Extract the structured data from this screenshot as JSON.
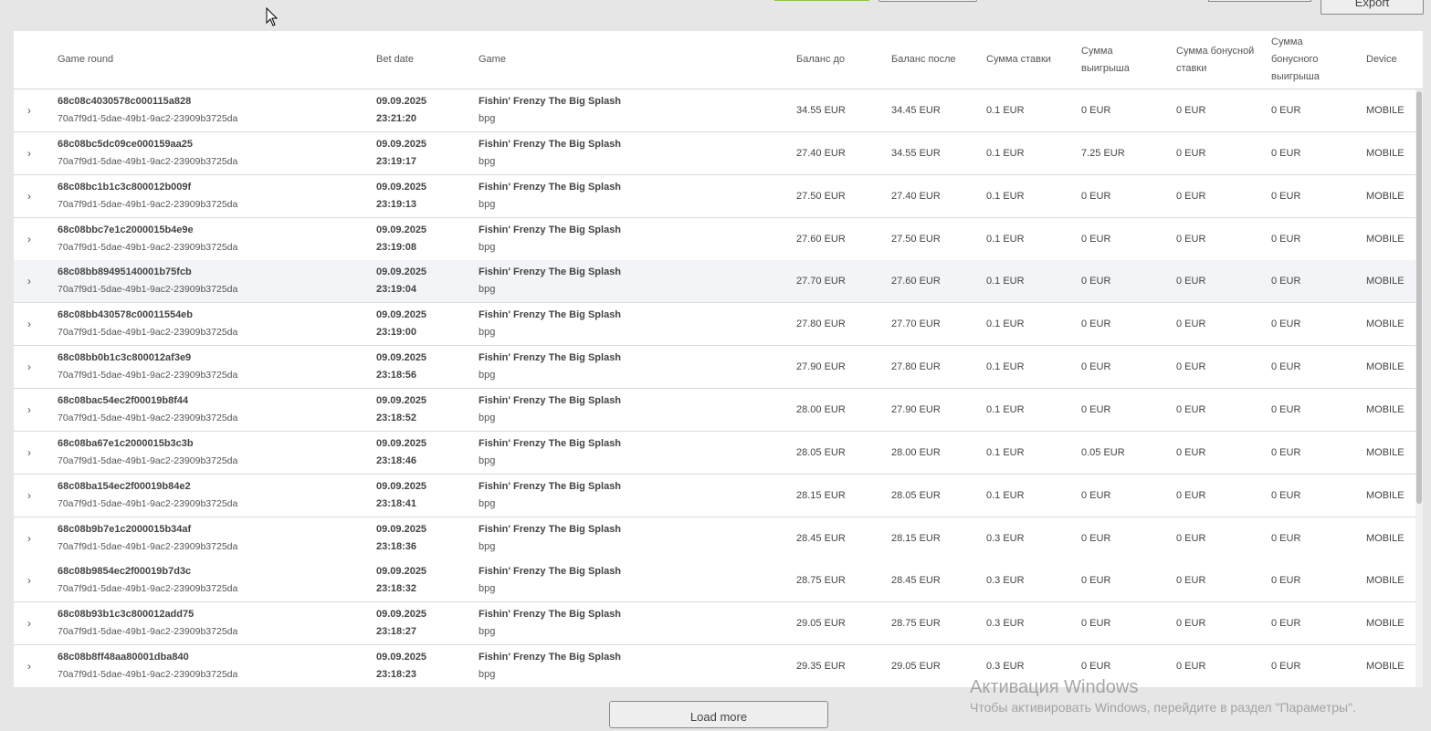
{
  "toolbar": {
    "export_label": "Export"
  },
  "table": {
    "headers": {
      "game_round": "Game round",
      "bet_date": "Bet date",
      "game": "Game",
      "balance_before": "Баланс до",
      "balance_after": "Баланс после",
      "bet_amount": "Сумма ставки",
      "win_amount": "Сумма выигрыша",
      "bonus_bet_amount": "Сумма бонусной ставки",
      "bonus_win_amount": "Сумма бонусного выигрыша",
      "device": "Device"
    },
    "rows": [
      {
        "round_id": "68c08c4030578c000115a828",
        "round_sub": "70a7f9d1-5dae-49b1-9ac2-23909b3725da",
        "date": "09.09.2025",
        "time": "23:21:20",
        "game": "Fishin' Frenzy The Big Splash",
        "provider": "bpg",
        "balance_before": "34.55 EUR",
        "balance_after": "34.45 EUR",
        "bet": "0.1 EUR",
        "win": "0 EUR",
        "bonus_bet": "0 EUR",
        "bonus_win": "0 EUR",
        "device": "MOBILE"
      },
      {
        "round_id": "68c08bc5dc09ce000159aa25",
        "round_sub": "70a7f9d1-5dae-49b1-9ac2-23909b3725da",
        "date": "09.09.2025",
        "time": "23:19:17",
        "game": "Fishin' Frenzy The Big Splash",
        "provider": "bpg",
        "balance_before": "27.40 EUR",
        "balance_after": "34.55 EUR",
        "bet": "0.1 EUR",
        "win": "7.25 EUR",
        "bonus_bet": "0 EUR",
        "bonus_win": "0 EUR",
        "device": "MOBILE"
      },
      {
        "round_id": "68c08bc1b1c3c800012b009f",
        "round_sub": "70a7f9d1-5dae-49b1-9ac2-23909b3725da",
        "date": "09.09.2025",
        "time": "23:19:13",
        "game": "Fishin' Frenzy The Big Splash",
        "provider": "bpg",
        "balance_before": "27.50 EUR",
        "balance_after": "27.40 EUR",
        "bet": "0.1 EUR",
        "win": "0 EUR",
        "bonus_bet": "0 EUR",
        "bonus_win": "0 EUR",
        "device": "MOBILE"
      },
      {
        "round_id": "68c08bbc7e1c2000015b4e9e",
        "round_sub": "70a7f9d1-5dae-49b1-9ac2-23909b3725da",
        "date": "09.09.2025",
        "time": "23:19:08",
        "game": "Fishin' Frenzy The Big Splash",
        "provider": "bpg",
        "balance_before": "27.60 EUR",
        "balance_after": "27.50 EUR",
        "bet": "0.1 EUR",
        "win": "0 EUR",
        "bonus_bet": "0 EUR",
        "bonus_win": "0 EUR",
        "device": "MOBILE"
      },
      {
        "round_id": "68c08bb89495140001b75fcb",
        "round_sub": "70a7f9d1-5dae-49b1-9ac2-23909b3725da",
        "date": "09.09.2025",
        "time": "23:19:04",
        "game": "Fishin' Frenzy The Big Splash",
        "provider": "bpg",
        "balance_before": "27.70 EUR",
        "balance_after": "27.60 EUR",
        "bet": "0.1 EUR",
        "win": "0 EUR",
        "bonus_bet": "0 EUR",
        "bonus_win": "0 EUR",
        "device": "MOBILE"
      },
      {
        "round_id": "68c08bb430578c00011554eb",
        "round_sub": "70a7f9d1-5dae-49b1-9ac2-23909b3725da",
        "date": "09.09.2025",
        "time": "23:19:00",
        "game": "Fishin' Frenzy The Big Splash",
        "provider": "bpg",
        "balance_before": "27.80 EUR",
        "balance_after": "27.70 EUR",
        "bet": "0.1 EUR",
        "win": "0 EUR",
        "bonus_bet": "0 EUR",
        "bonus_win": "0 EUR",
        "device": "MOBILE"
      },
      {
        "round_id": "68c08bb0b1c3c800012af3e9",
        "round_sub": "70a7f9d1-5dae-49b1-9ac2-23909b3725da",
        "date": "09.09.2025",
        "time": "23:18:56",
        "game": "Fishin' Frenzy The Big Splash",
        "provider": "bpg",
        "balance_before": "27.90 EUR",
        "balance_after": "27.80 EUR",
        "bet": "0.1 EUR",
        "win": "0 EUR",
        "bonus_bet": "0 EUR",
        "bonus_win": "0 EUR",
        "device": "MOBILE"
      },
      {
        "round_id": "68c08bac54ec2f00019b8f44",
        "round_sub": "70a7f9d1-5dae-49b1-9ac2-23909b3725da",
        "date": "09.09.2025",
        "time": "23:18:52",
        "game": "Fishin' Frenzy The Big Splash",
        "provider": "bpg",
        "balance_before": "28.00 EUR",
        "balance_after": "27.90 EUR",
        "bet": "0.1 EUR",
        "win": "0 EUR",
        "bonus_bet": "0 EUR",
        "bonus_win": "0 EUR",
        "device": "MOBILE"
      },
      {
        "round_id": "68c08ba67e1c2000015b3c3b",
        "round_sub": "70a7f9d1-5dae-49b1-9ac2-23909b3725da",
        "date": "09.09.2025",
        "time": "23:18:46",
        "game": "Fishin' Frenzy The Big Splash",
        "provider": "bpg",
        "balance_before": "28.05 EUR",
        "balance_after": "28.00 EUR",
        "bet": "0.1 EUR",
        "win": "0.05 EUR",
        "bonus_bet": "0 EUR",
        "bonus_win": "0 EUR",
        "device": "MOBILE"
      },
      {
        "round_id": "68c08ba154ec2f00019b84e2",
        "round_sub": "70a7f9d1-5dae-49b1-9ac2-23909b3725da",
        "date": "09.09.2025",
        "time": "23:18:41",
        "game": "Fishin' Frenzy The Big Splash",
        "provider": "bpg",
        "balance_before": "28.15 EUR",
        "balance_after": "28.05 EUR",
        "bet": "0.1 EUR",
        "win": "0 EUR",
        "bonus_bet": "0 EUR",
        "bonus_win": "0 EUR",
        "device": "MOBILE"
      },
      {
        "round_id": "68c08b9b7e1c2000015b34af",
        "round_sub": "70a7f9d1-5dae-49b1-9ac2-23909b3725da",
        "date": "09.09.2025",
        "time": "23:18:36",
        "game": "Fishin' Frenzy The Big Splash",
        "provider": "bpg",
        "balance_before": "28.45 EUR",
        "balance_after": "28.15 EUR",
        "bet": "0.3 EUR",
        "win": "0 EUR",
        "bonus_bet": "0 EUR",
        "bonus_win": "0 EUR",
        "device": "MOBILE"
      },
      {
        "round_id": "68c08b9854ec2f00019b7d3c",
        "round_sub": "70a7f9d1-5dae-49b1-9ac2-23909b3725da",
        "date": "09.09.2025",
        "time": "23:18:32",
        "game": "Fishin' Frenzy The Big Splash",
        "provider": "bpg",
        "balance_before": "28.75 EUR",
        "balance_after": "28.45 EUR",
        "bet": "0.3 EUR",
        "win": "0 EUR",
        "bonus_bet": "0 EUR",
        "bonus_win": "0 EUR",
        "device": "MOBILE"
      },
      {
        "round_id": "68c08b93b1c3c800012add75",
        "round_sub": "70a7f9d1-5dae-49b1-9ac2-23909b3725da",
        "date": "09.09.2025",
        "time": "23:18:27",
        "game": "Fishin' Frenzy The Big Splash",
        "provider": "bpg",
        "balance_before": "29.05 EUR",
        "balance_after": "28.75 EUR",
        "bet": "0.3 EUR",
        "win": "0 EUR",
        "bonus_bet": "0 EUR",
        "bonus_win": "0 EUR",
        "device": "MOBILE"
      },
      {
        "round_id": "68c08b8ff48aa80001dba840",
        "round_sub": "70a7f9d1-5dae-49b1-9ac2-23909b3725da",
        "date": "09.09.2025",
        "time": "23:18:23",
        "game": "Fishin' Frenzy The Big Splash",
        "provider": "bpg",
        "balance_before": "29.35 EUR",
        "balance_after": "29.05 EUR",
        "bet": "0.3 EUR",
        "win": "0 EUR",
        "bonus_bet": "0 EUR",
        "bonus_win": "0 EUR",
        "device": "MOBILE"
      }
    ],
    "highlighted_row_index": 4
  },
  "footer": {
    "load_more_label": "Load more"
  },
  "watermark": {
    "title": "Активация Windows",
    "subtitle": "Чтобы активировать Windows, перейдите в раздел \"Параметры\"."
  },
  "colors": {
    "accent_green": "#8cc63f",
    "row_highlight": "#f2f4f8"
  }
}
